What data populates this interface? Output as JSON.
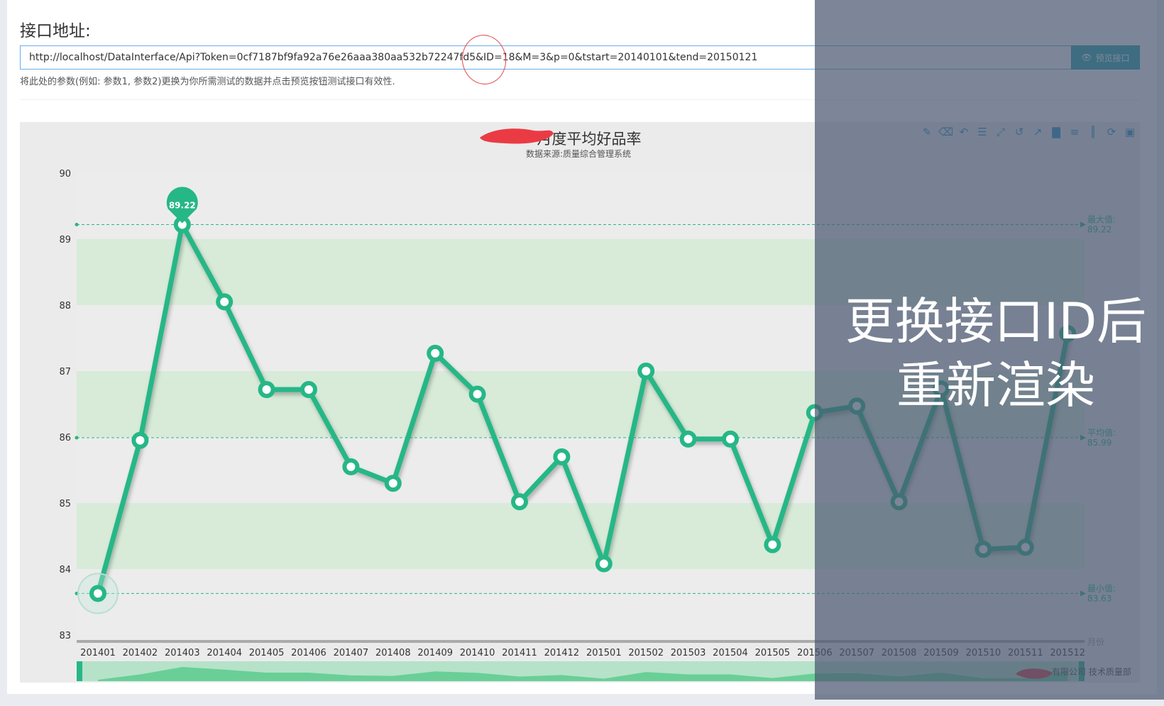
{
  "api": {
    "title": "接口地址:",
    "url": "http://localhost/DataInterface/Api?Token=0cf7187bf9fa92a76e26aaa380aa532b72247fd5&ID=18&M=3&p=0&tstart=20140101&tend=20150121",
    "preview_label": "预览接口",
    "preview_icon": "eye-icon",
    "hint": "将此处的参数(例如: 参数1, 参数2)更换为你所需测试的数据并点击预览按钮测试接口有效性."
  },
  "chart": {
    "title": "月度平均好品率",
    "subtitle": "数据来源:质量综合管理系统",
    "max_label_line1": "最大值:",
    "max_label_line2": "89.22",
    "avg_label_line1": "平均值:",
    "avg_label_line2": "85.99",
    "min_label_line1": "最小值:",
    "min_label_line2": "83.63",
    "pin_label": "89.22",
    "x_axis_name": "月份",
    "footer_credit": "有限公司 技术质量部"
  },
  "toolbar": {
    "icons": [
      "pencil-icon",
      "eraser-icon",
      "undo-icon",
      "data-view-icon",
      "zoom-icon",
      "restore-zoom-icon",
      "line-chart-icon",
      "bar-chart-icon",
      "stack-icon",
      "tiled-icon",
      "refresh-icon",
      "save-icon"
    ]
  },
  "overlay": {
    "line1": "更换接口ID后",
    "line2": "重新渲染"
  },
  "chart_data": {
    "type": "line",
    "title": "月度平均好品率",
    "subtitle": "数据来源:质量综合管理系统",
    "xlabel": "月份",
    "ylabel": "",
    "ylim": [
      83,
      90
    ],
    "yticks": [
      83,
      84,
      85,
      86,
      87,
      88,
      89,
      90
    ],
    "categories": [
      "201401",
      "201402",
      "201403",
      "201404",
      "201405",
      "201406",
      "201407",
      "201408",
      "201409",
      "201410",
      "201411",
      "201412",
      "201501",
      "201502",
      "201503",
      "201504",
      "201505",
      "201506",
      "201507",
      "201508",
      "201509",
      "201510",
      "201511",
      "201512"
    ],
    "series": [
      {
        "values": [
          83.63,
          85.95,
          89.22,
          88.05,
          86.72,
          86.72,
          85.55,
          85.3,
          87.27,
          86.65,
          85.02,
          85.7,
          84.08,
          87.0,
          85.97,
          85.97,
          84.37,
          86.37,
          86.47,
          85.02,
          86.73,
          84.3,
          84.33,
          87.57
        ],
        "color": "#26b787"
      }
    ],
    "mark_lines": {
      "max": 89.22,
      "avg": 85.99,
      "min": 83.63
    },
    "grid": false,
    "legend": "none"
  }
}
